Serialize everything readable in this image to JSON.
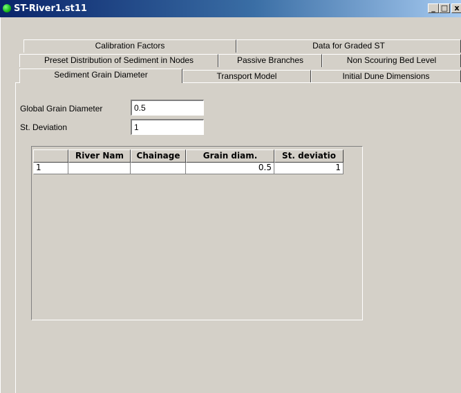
{
  "window": {
    "title": "ST-River1.st11"
  },
  "title_buttons": {
    "minimize": "_",
    "maximize": "□",
    "close": "x"
  },
  "tabs": {
    "row1": [
      "Calibration Factors",
      "Data for Graded ST"
    ],
    "row2": [
      "Preset Distribution of Sediment in Nodes",
      "Passive Branches",
      "Non Scouring Bed Level"
    ],
    "row3": [
      "Sediment Grain Diameter",
      "Transport Model",
      "Initial Dune Dimensions"
    ],
    "active": "Sediment Grain Diameter"
  },
  "form": {
    "global_grain_diameter_label": "Global Grain Diameter",
    "global_grain_diameter_value": "0.5",
    "st_deviation_label": "St. Deviation",
    "st_deviation_value": "1"
  },
  "grid": {
    "columns": [
      "",
      "River Nam",
      "Chainage",
      "Grain diam.",
      "St. deviatio"
    ],
    "rows": [
      {
        "index": "1",
        "river_name": "",
        "chainage": "",
        "grain_diam": "0.5",
        "st_deviation": "1"
      }
    ]
  }
}
